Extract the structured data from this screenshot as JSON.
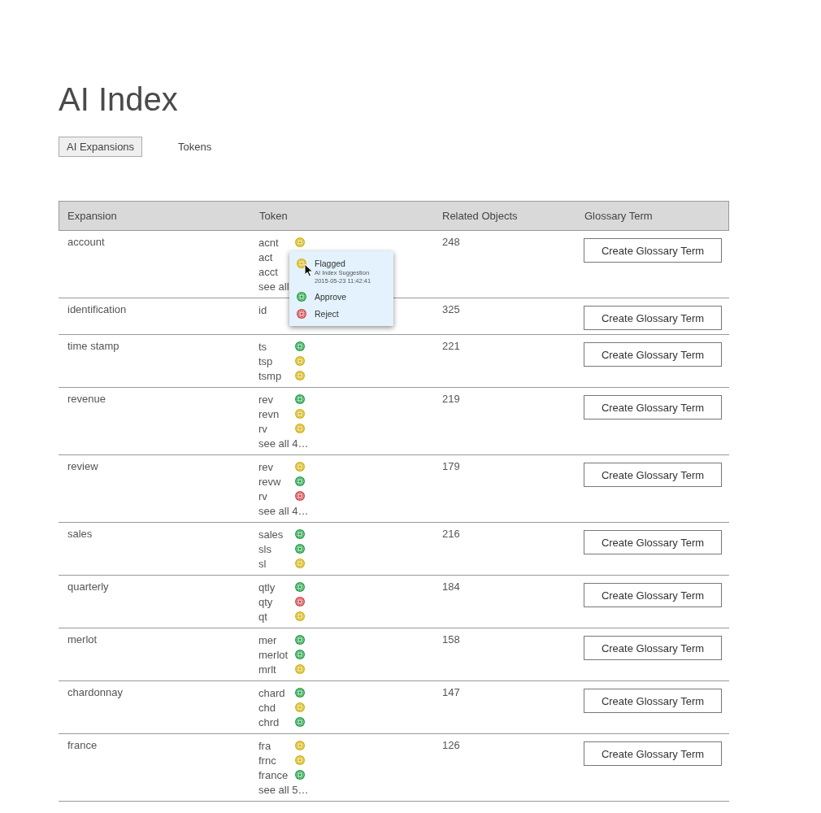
{
  "title": "AI Index",
  "tabs": [
    {
      "label": "AI Expansions",
      "selected": true
    },
    {
      "label": "Tokens",
      "selected": false
    }
  ],
  "table": {
    "columns": [
      "Expansion",
      "Token",
      "Related Objects",
      "Glossary Term"
    ],
    "rows": [
      {
        "expansion": "account",
        "tokens": [
          {
            "text": "acnt",
            "kind": "flagged"
          },
          {
            "text": "act"
          },
          {
            "text": "acct"
          }
        ],
        "see_all": "see all",
        "related": "248",
        "button": "Create Glossary Term"
      },
      {
        "expansion": "identification",
        "tokens": [
          {
            "text": "id"
          }
        ],
        "related": "325",
        "button": "Create Glossary Term"
      },
      {
        "expansion": "time stamp",
        "tokens": [
          {
            "text": "ts",
            "kind": "approved"
          },
          {
            "text": "tsp",
            "kind": "flagged"
          },
          {
            "text": "tsmp",
            "kind": "flagged"
          }
        ],
        "related": "221",
        "button": "Create Glossary Term"
      },
      {
        "expansion": "revenue",
        "tokens": [
          {
            "text": "rev",
            "kind": "approved"
          },
          {
            "text": "revn",
            "kind": "flagged"
          },
          {
            "text": "rv",
            "kind": "flagged"
          }
        ],
        "see_all": "see all 4…",
        "related": "219",
        "button": "Create Glossary Term"
      },
      {
        "expansion": "review",
        "tokens": [
          {
            "text": "rev",
            "kind": "flagged"
          },
          {
            "text": "revw",
            "kind": "approved"
          },
          {
            "text": "rv",
            "kind": "rejected"
          }
        ],
        "see_all": "see all 4…",
        "related": "179",
        "button": "Create Glossary Term"
      },
      {
        "expansion": "sales",
        "tokens": [
          {
            "text": "sales",
            "kind": "approved"
          },
          {
            "text": "sls",
            "kind": "approved"
          },
          {
            "text": "sl",
            "kind": "flagged"
          }
        ],
        "related": "216",
        "button": "Create Glossary Term"
      },
      {
        "expansion": "quarterly",
        "tokens": [
          {
            "text": "qtly",
            "kind": "approved"
          },
          {
            "text": "qty",
            "kind": "rejected"
          },
          {
            "text": "qt",
            "kind": "flagged"
          }
        ],
        "related": "184",
        "button": "Create Glossary Term"
      },
      {
        "expansion": "merlot",
        "tokens": [
          {
            "text": "mer",
            "kind": "approved"
          },
          {
            "text": "merlot",
            "kind": "approved"
          },
          {
            "text": "mrlt",
            "kind": "flagged"
          }
        ],
        "related": "158",
        "button": "Create Glossary Term"
      },
      {
        "expansion": "chardonnay",
        "tokens": [
          {
            "text": "chard",
            "kind": "approved"
          },
          {
            "text": "chd",
            "kind": "flagged"
          },
          {
            "text": "chrd",
            "kind": "approved"
          }
        ],
        "related": "147",
        "button": "Create Glossary Term"
      },
      {
        "expansion": "france",
        "tokens": [
          {
            "text": "fra",
            "kind": "flagged"
          },
          {
            "text": "frnc",
            "kind": "flagged"
          },
          {
            "text": "france",
            "kind": "approved"
          }
        ],
        "see_all": "see all 5…",
        "related": "126",
        "button": "Create Glossary Term"
      }
    ]
  },
  "status_menu": {
    "items": [
      {
        "kind": "flagged",
        "label": "Flagged",
        "details": [
          "AI Index Suggestion",
          "2015-05-23 11:42:41"
        ]
      },
      {
        "kind": "approved",
        "label": "Approve"
      },
      {
        "kind": "rejected",
        "label": "Reject"
      }
    ]
  }
}
